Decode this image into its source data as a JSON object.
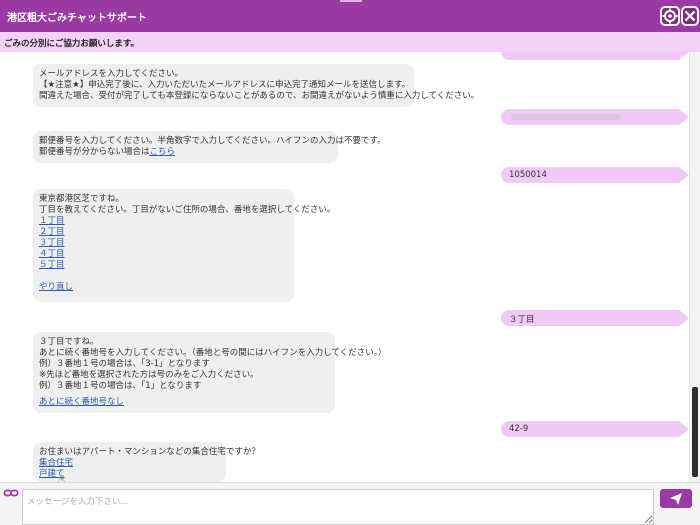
{
  "header": {
    "title": "港区粗大ごみチャットサポート",
    "settings_icon": "gear-icon",
    "close_icon": "close-icon",
    "brand_color": "#9b3aa5"
  },
  "notice": {
    "text": "ごみの分別にご協力お願いします。"
  },
  "messages": {
    "email_prompt": {
      "lines": [
        "メールアドレスを入力してください。",
        "【★注意★】申込完了後に、入力いただいたメールアドレスに申込完了通知メールを送信します。",
        "間違えた場合、受付が完了しても本登録にならないことがあるので、お間違えがないよう慎重に入力してください。"
      ]
    },
    "postal_prompt": {
      "line1": "郵便番号を入力してください。半角数字で入力してください。ハイフンの入力は不要です。",
      "line2_prefix": "郵便番号が分からない場合は",
      "line2_link": "こちら"
    },
    "postal_reply": "1050014",
    "chome_prompt": {
      "lines": [
        "東京都港区芝ですね。",
        "丁目を教えてください。丁目がないご住所の場合、番地を選択してください。"
      ],
      "options": [
        "１丁目",
        "２丁目",
        "３丁目",
        "４丁目",
        "５丁目"
      ],
      "redo": "やり直し"
    },
    "chome_reply": "３丁目",
    "banchi_prompt": {
      "lines": [
        "３丁目ですね。",
        "あとに続く番地号を入力してください。（番地と号の間にはハイフンを入力してください。）",
        "例）３番地１号の場合は、「3-1」となります",
        "※先ほど番地を選択された方は号のみをご入力ください。",
        "例）３番地１号の場合は、「1」となります"
      ],
      "link": "あとに続く番地号なし"
    },
    "banchi_reply": "42-9",
    "housing_prompt": {
      "question": "お住まいはアパート・マンションなどの集合住宅ですか？",
      "options": [
        "集合住宅",
        "戸建て"
      ]
    }
  },
  "input": {
    "placeholder": "メッセージを入力下さい...",
    "send_icon": "send-icon",
    "link_icon": "link-icon"
  }
}
